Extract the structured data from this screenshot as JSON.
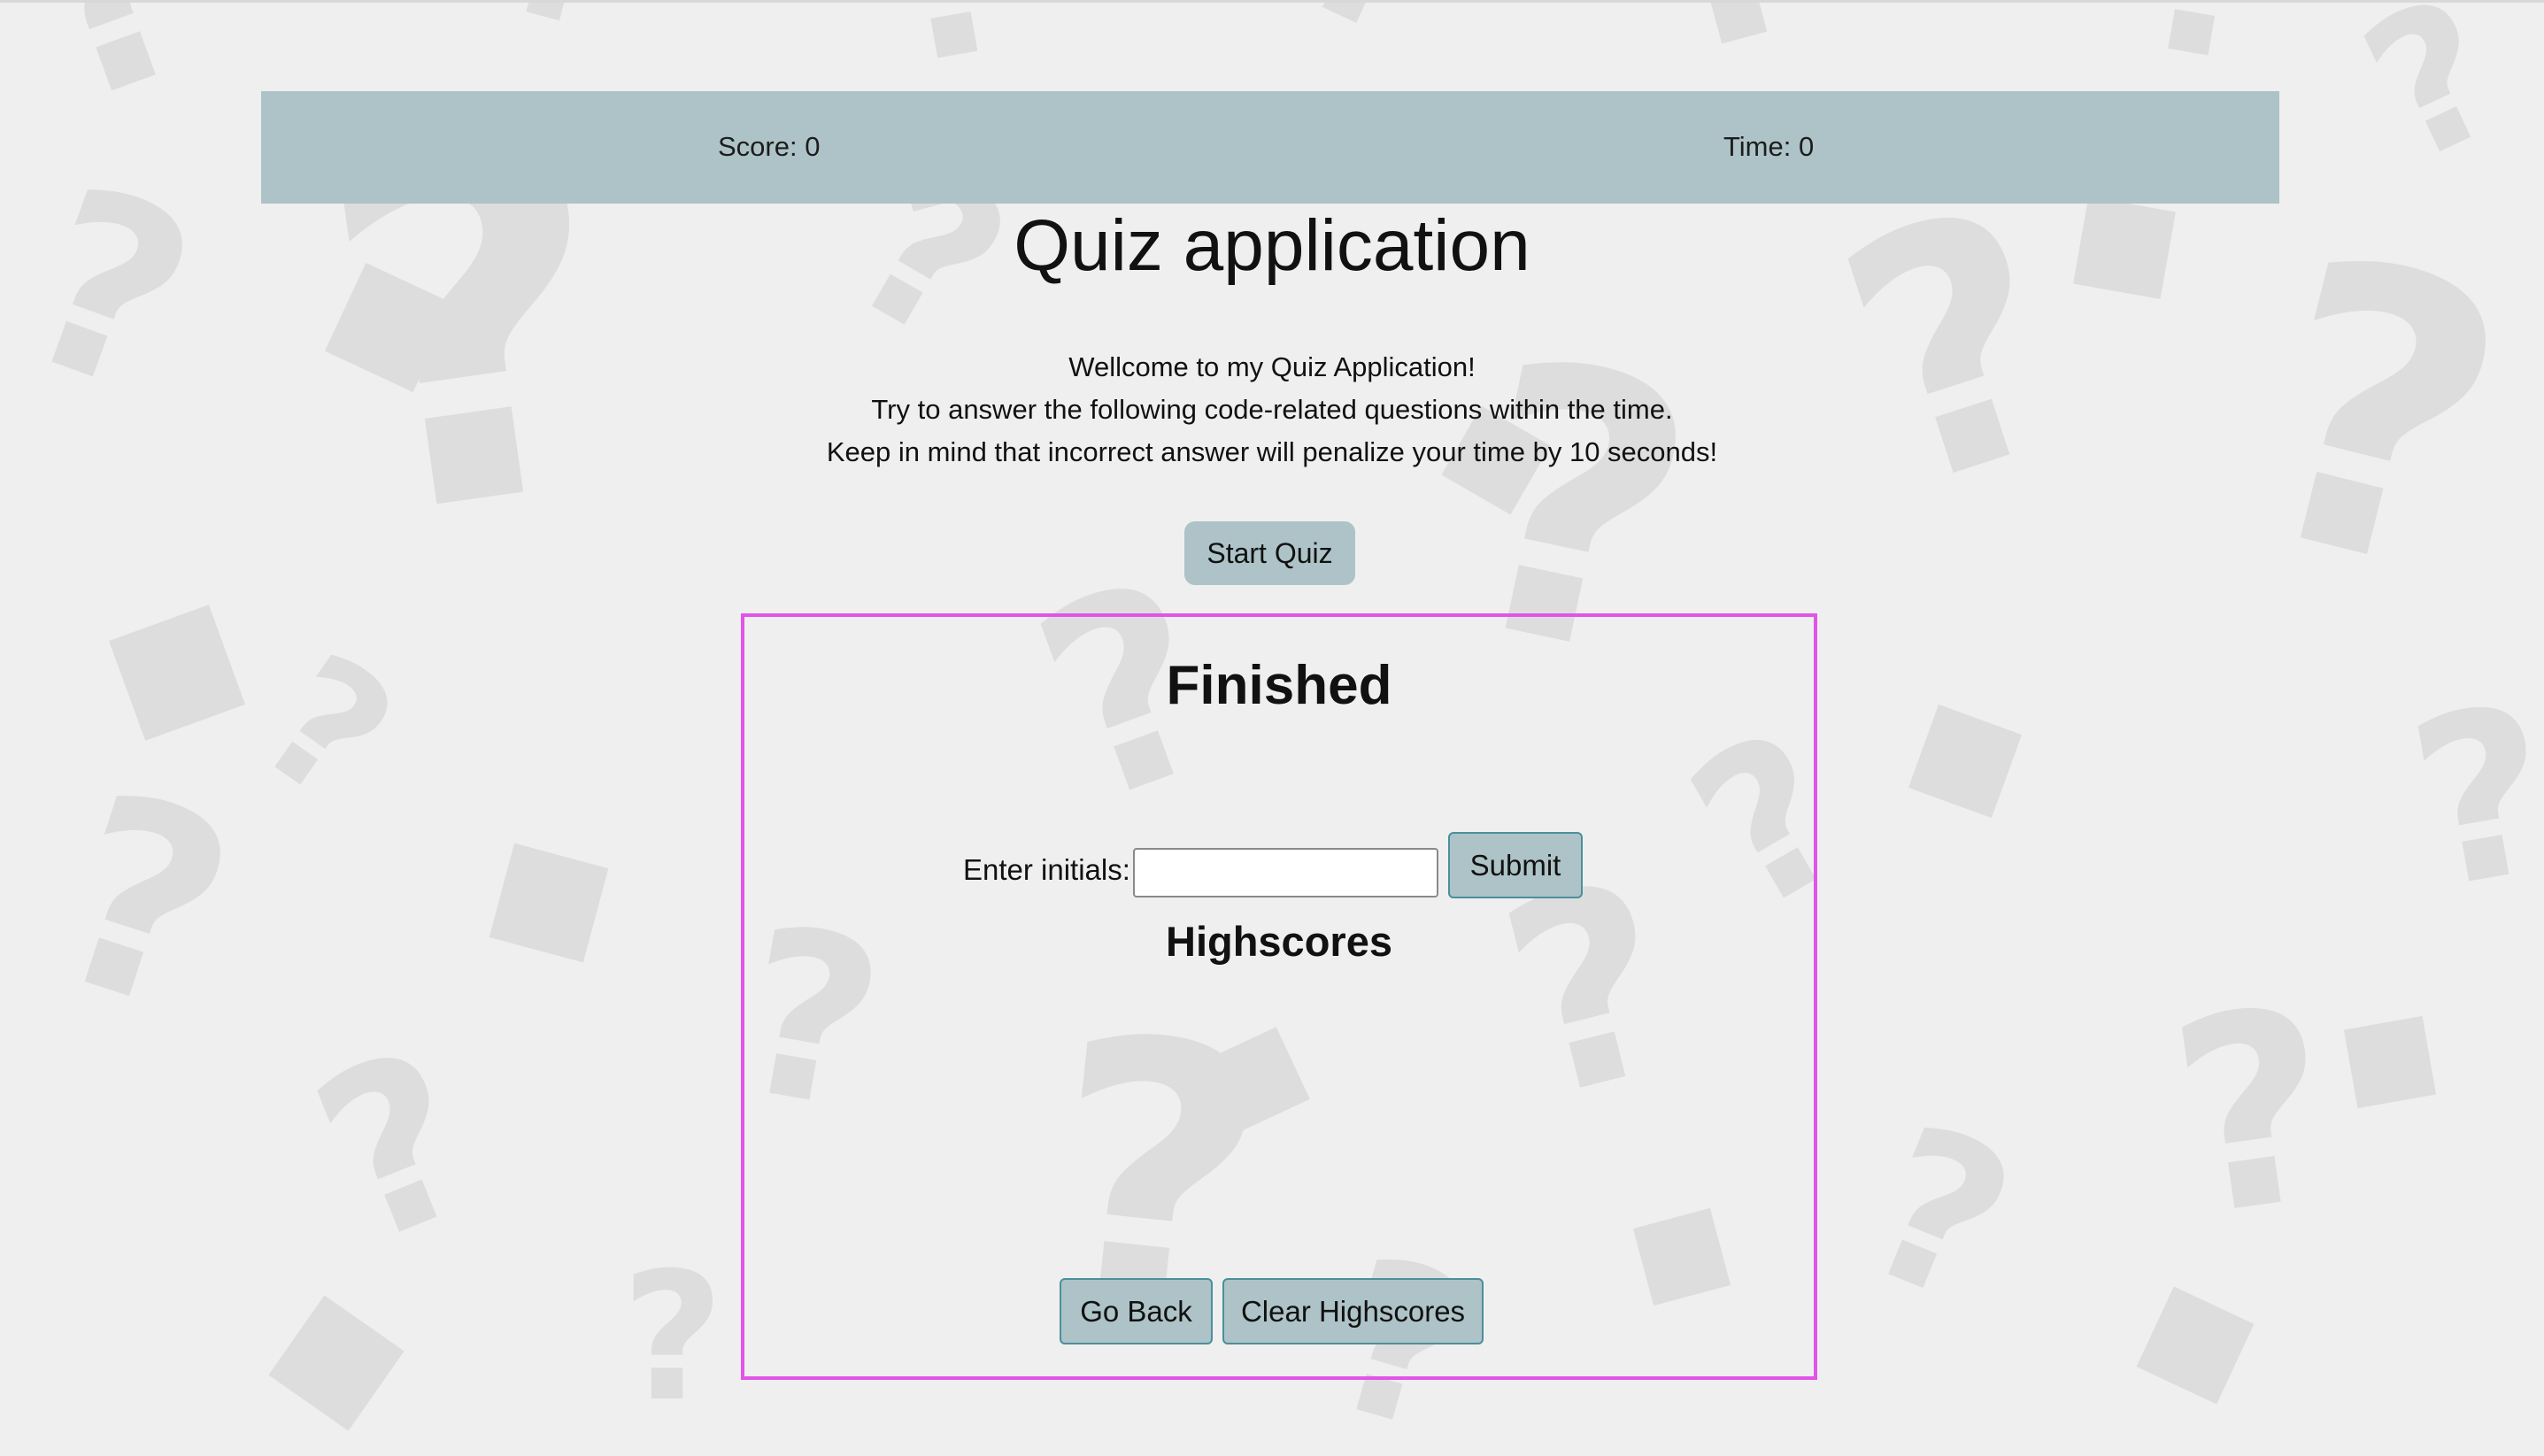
{
  "header": {
    "score_text": "Score: 0",
    "time_text": "Time: 0"
  },
  "page": {
    "title": "Quiz application",
    "intro_lines": [
      "Wellcome to my Quiz Application!",
      "Try to answer the following code-related questions within the time.",
      "Keep in mind that incorrect answer will penalize your time by 10 seconds!"
    ],
    "start_button_label": "Start Quiz"
  },
  "finished": {
    "title": "Finished",
    "initials_label": "Enter initials:",
    "initials_value": "",
    "submit_label": "Submit",
    "highscores_title": "Highscores",
    "highscores": [],
    "go_back_label": "Go Back",
    "clear_label": "Clear Highscores"
  },
  "colors": {
    "page_background": "#efefef",
    "background_pattern": "#dddddd",
    "header_bar": "#adc3c7",
    "button_background": "#adc3c7",
    "button_border": "#4b8f9c",
    "highlight_border": "#e054e8"
  },
  "background": {
    "pattern_icon": "question-mark-pattern-icon"
  }
}
